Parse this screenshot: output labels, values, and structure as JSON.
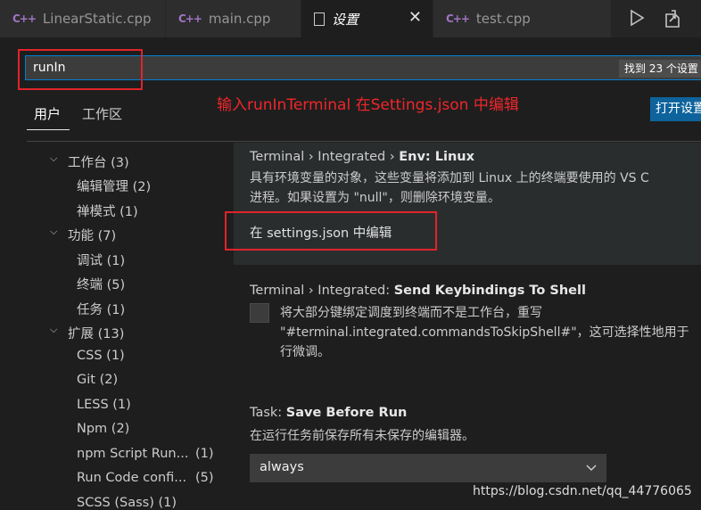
{
  "tabs": [
    {
      "label": "LinearStatic.cpp",
      "icon": "cpp-icon"
    },
    {
      "label": "main.cpp",
      "icon": "cpp-icon"
    },
    {
      "label": "设置",
      "icon": "file-icon",
      "close": "✕"
    },
    {
      "label": "test.cpp",
      "icon": "cpp-icon"
    }
  ],
  "cpp_glyph": "C++",
  "search": {
    "value": "runIn",
    "result_count": "找到 23 个设置"
  },
  "annotation": "输入runInTerminal 在Settings.json 中编辑",
  "scope_tabs": [
    "用户",
    "工作区"
  ],
  "open_json_button": "打开设置",
  "toc": [
    {
      "label": "工作台",
      "count": "(3)",
      "chevron": "⌵"
    },
    {
      "label": "编辑管理",
      "count": "(2)"
    },
    {
      "label": "禅模式",
      "count": "(1)"
    },
    {
      "label": "功能",
      "count": "(7)",
      "chevron": "⌵"
    },
    {
      "label": "调试",
      "count": "(1)"
    },
    {
      "label": "终端",
      "count": "(5)"
    },
    {
      "label": "任务",
      "count": "(1)"
    },
    {
      "label": "扩展",
      "count": "(13)",
      "chevron": "⌵"
    },
    {
      "label": "CSS",
      "count": "(1)"
    },
    {
      "label": "Git",
      "count": "(2)"
    },
    {
      "label": "LESS",
      "count": "(1)"
    },
    {
      "label": "Npm",
      "count": "(2)"
    },
    {
      "label": "npm Script Run...",
      "count": "(1)"
    },
    {
      "label": "Run Code confi...",
      "count": "(5)"
    },
    {
      "label": "SCSS (Sass)",
      "count": "(1)"
    }
  ],
  "settings": {
    "env_linux": {
      "prefix": "Terminal › Integrated › ",
      "name": "Env: Linux",
      "desc1": "具有环境变量的对象，这些变量将添加到 Linux 上的终端要使用的 VS C",
      "desc2": "进程。如果设置为 \"null\"，则删除环境变量。",
      "link": "在 settings.json 中编辑"
    },
    "send_keybindings": {
      "prefix": "Terminal › Integrated: ",
      "name": "Send Keybindings To Shell",
      "desc1": "将大部分键绑定调度到终端而不是工作台，重写",
      "desc2": "\"#terminal.integrated.commandsToSkipShell#\"，这可选择性地用于",
      "desc3": "行微调。",
      "checked": false
    },
    "save_before_run": {
      "prefix": "Task: ",
      "name": "Save Before Run",
      "desc": "在运行任务前保存所有未保存的编辑器。",
      "value": "always"
    }
  },
  "watermark": "https://blog.csdn.net/qq_44776065",
  "colors": {
    "accent": "#007fd4",
    "annotation_red": "#e0242a",
    "cpp_icon": "#a074c4",
    "button": "#0e639c"
  }
}
